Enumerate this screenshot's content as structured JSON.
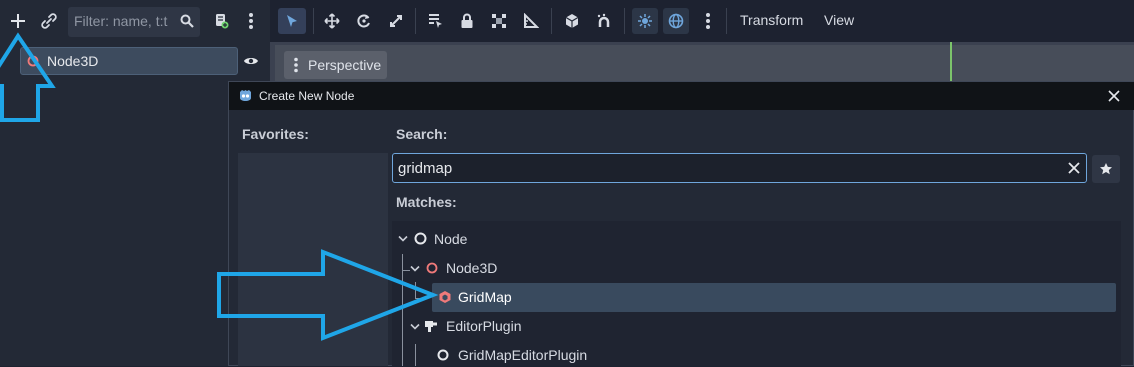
{
  "scene_dock": {
    "filter_placeholder": "Filter: name, t:t",
    "tree": [
      {
        "label": "Node3D"
      }
    ]
  },
  "viewport": {
    "menus": [
      "Transform",
      "View"
    ],
    "perspective_label": "Perspective"
  },
  "dialog": {
    "title": "Create New Node",
    "favorites_label": "Favorites:",
    "search_label": "Search:",
    "search_value": "gridmap",
    "matches_label": "Matches:",
    "matches": [
      {
        "label": "Node"
      },
      {
        "label": "Node3D"
      },
      {
        "label": "GridMap",
        "selected": true
      },
      {
        "label": "EditorPlugin"
      },
      {
        "label": "GridMapEditorPlugin"
      }
    ]
  },
  "colors": {
    "accent": "#6fa6dc",
    "node3d_icon": "#f07a7a",
    "annotation_arrow": "#1fa6e8"
  }
}
